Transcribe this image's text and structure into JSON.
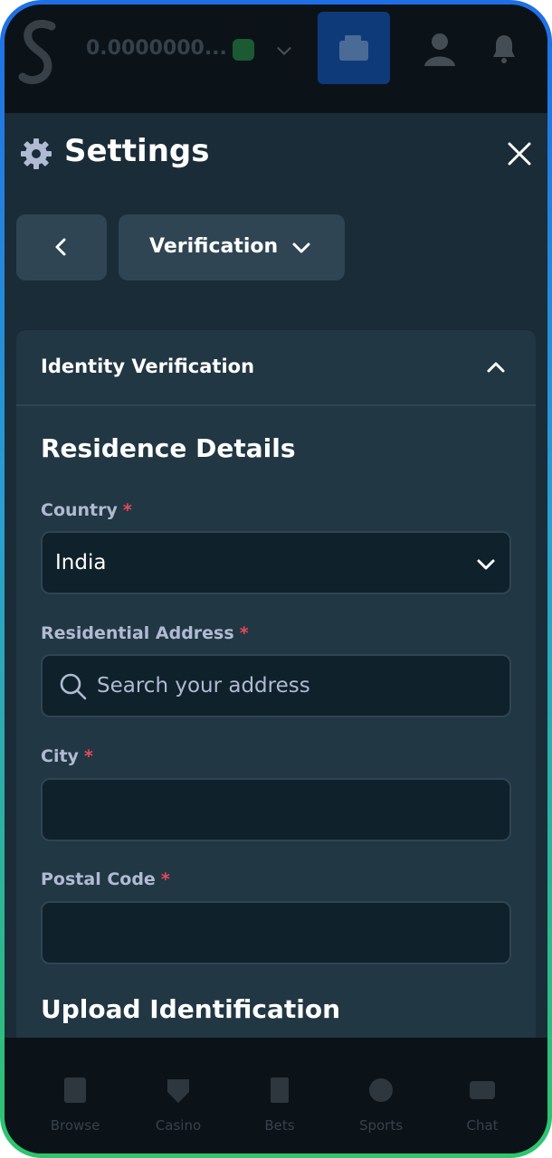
{
  "header": {
    "balance": "0.0000000...",
    "colors": {
      "wallet_button": "#0f3a7a",
      "coin": "#1b5a32"
    }
  },
  "settings": {
    "title": "Settings",
    "section_select_value": "Verification",
    "accordion_title": "Identity Verification",
    "residence_heading": "Residence Details",
    "country": {
      "label": "Country",
      "required": "*",
      "value": "India"
    },
    "address": {
      "label": "Residential Address",
      "required": "*",
      "placeholder": "Search your address",
      "value": ""
    },
    "city": {
      "label": "City",
      "required": "*",
      "value": ""
    },
    "postal": {
      "label": "Postal Code",
      "required": "*",
      "value": ""
    },
    "upload_heading": "Upload Identification"
  },
  "bottom_nav": {
    "items": [
      {
        "label": "Browse",
        "icon": "book-icon"
      },
      {
        "label": "Casino",
        "icon": "card-icon"
      },
      {
        "label": "Bets",
        "icon": "ticket-icon"
      },
      {
        "label": "Sports",
        "icon": "ball-icon"
      },
      {
        "label": "Chat",
        "icon": "chat-icon"
      }
    ]
  },
  "colors": {
    "panel_bg": "#1a2c38",
    "card_bg": "#213743",
    "input_bg": "#0f212b",
    "button_bg": "#2f4553",
    "required": "#e9485a",
    "label": "#b1bad3"
  }
}
